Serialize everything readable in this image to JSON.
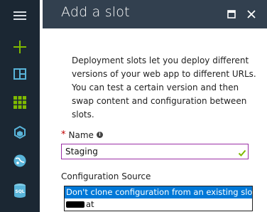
{
  "sidebar": {
    "items": [
      {
        "name": "hamburger-menu-icon"
      },
      {
        "name": "new-plus-icon",
        "color": "#7fba00"
      },
      {
        "name": "dashboard-icon",
        "color": "#59b4d9"
      },
      {
        "name": "all-resources-grid-icon",
        "color": "#7fba00"
      },
      {
        "name": "resource-groups-cube-icon",
        "color": "#59b4d9"
      },
      {
        "name": "app-services-globe-icon",
        "color": "#59b4d9"
      },
      {
        "name": "sql-database-icon",
        "color": "#59b4d9"
      }
    ]
  },
  "blade": {
    "title": "Add a slot",
    "maximize_icon": "maximize-icon",
    "close_icon": "close-icon",
    "description": "Deployment slots let you deploy different versions of your web app to different URLs. You can test a certain version and then swap content and configuration between slots.",
    "name_label": "Name",
    "required_marker": "*",
    "name_value": "Staging",
    "config_source_label": "Configuration Source",
    "config_options": [
      "Don't clone configuration from an existing slot",
      "at"
    ]
  },
  "colors": {
    "rail_bg": "#1b2733",
    "header_bg": "#32404f",
    "selected_option": "#0078d7",
    "input_border": "#9a2fa6",
    "valid_check": "#7fba00"
  }
}
